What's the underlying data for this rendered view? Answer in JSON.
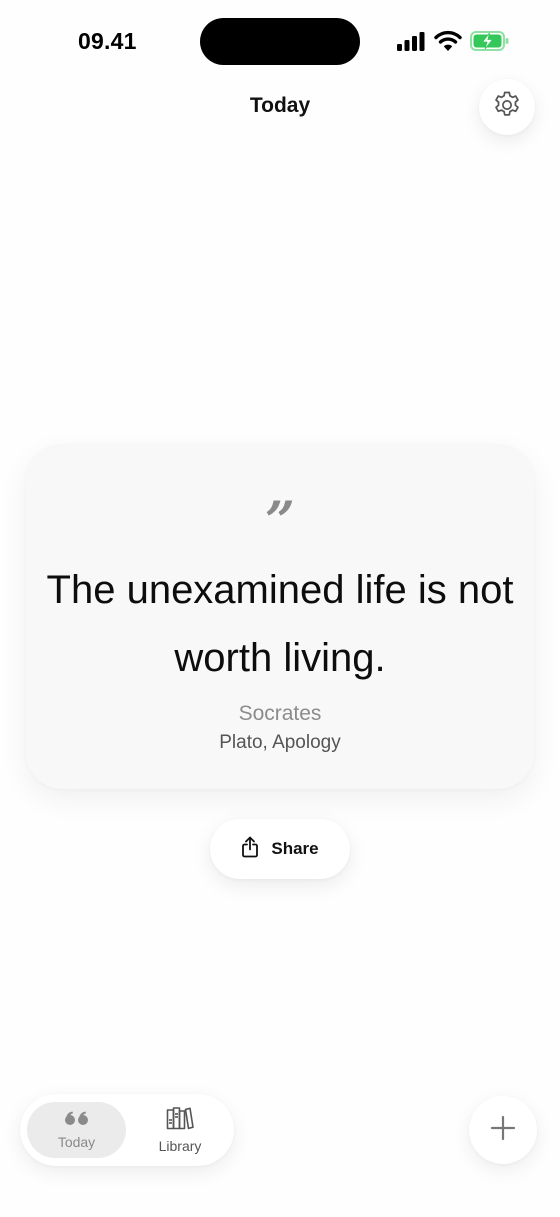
{
  "status_bar": {
    "time": "09.41",
    "icons": [
      "cellular-signal-icon",
      "wifi-icon",
      "battery-charging-icon"
    ],
    "battery_color": "#34c759"
  },
  "header": {
    "title": "Today",
    "settings_icon": "gear-icon"
  },
  "quote": {
    "mark": "”",
    "text": "The unexamined life is not worth living.",
    "author": "Socrates",
    "source": "Plato, Apology"
  },
  "share": {
    "label": "Share",
    "icon": "share-icon"
  },
  "tab_bar": {
    "items": [
      {
        "label": "Today",
        "icon": "quote-icon",
        "selected": true
      },
      {
        "label": "Library",
        "icon": "books-icon",
        "selected": false
      }
    ]
  },
  "add_button": {
    "icon": "plus-icon"
  },
  "colors": {
    "background": "#fefefe",
    "card": "#f8f8f8",
    "selected_tab": "#ebebeb",
    "muted_text": "#8c8c8c"
  }
}
